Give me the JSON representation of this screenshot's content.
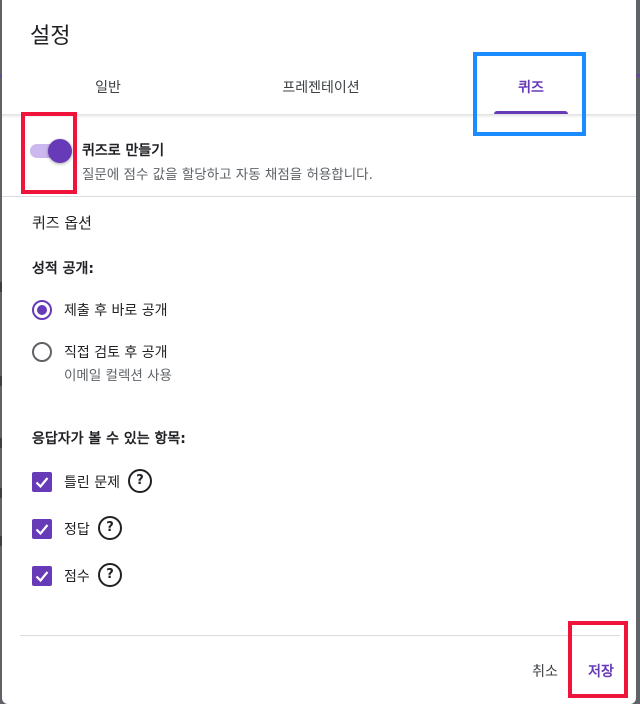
{
  "dialog": {
    "title": "설정"
  },
  "tabs": [
    {
      "label": "일반",
      "active": false
    },
    {
      "label": "프레젠테이션",
      "active": false
    },
    {
      "label": "퀴즈",
      "active": true
    }
  ],
  "quiz_toggle": {
    "label": "퀴즈로 만들기",
    "description": "질문에 점수 값을 할당하고 자동 채점을 허용합니다.",
    "on": true
  },
  "quiz_options": {
    "title": "퀴즈 옵션",
    "release": {
      "label": "성적 공개:",
      "options": [
        {
          "label": "제출 후 바로 공개",
          "selected": true
        },
        {
          "label": "직접 검토 후 공개",
          "sublabel": "이메일 컬렉션 사용",
          "selected": false
        }
      ]
    },
    "visible": {
      "label": "응답자가 볼 수 있는 항목:",
      "items": [
        {
          "label": "틀린 문제",
          "checked": true
        },
        {
          "label": "정답",
          "checked": true
        },
        {
          "label": "점수",
          "checked": true
        }
      ]
    }
  },
  "help_icon_glyph": "?",
  "footer": {
    "cancel_label": "취소",
    "save_label": "저장"
  },
  "colors": {
    "accent": "#673ab7",
    "highlight_red": "#f0143c",
    "highlight_blue": "#1a8cff",
    "overlay": "#5f6368"
  }
}
